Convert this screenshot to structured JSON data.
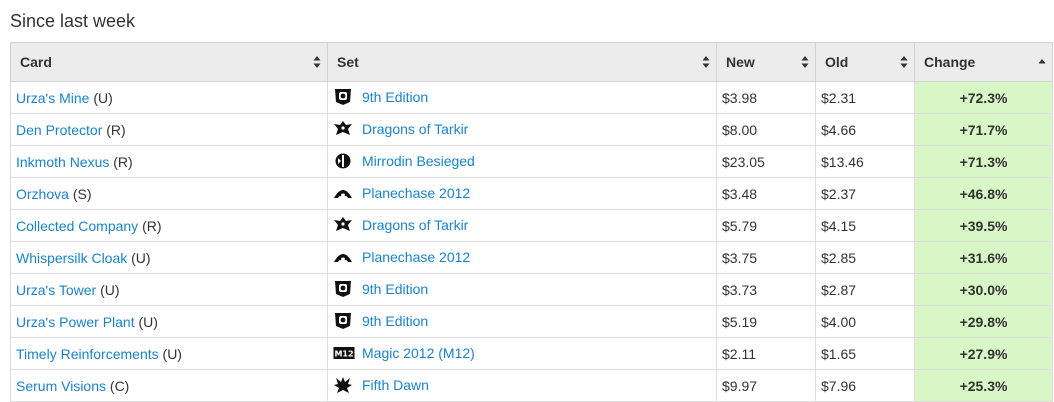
{
  "heading": "Since last week",
  "columns": [
    {
      "label": "Card",
      "sort": "both"
    },
    {
      "label": "Set",
      "sort": "both"
    },
    {
      "label": "New",
      "sort": "both"
    },
    {
      "label": "Old",
      "sort": "both"
    },
    {
      "label": "Change",
      "sort": "up"
    }
  ],
  "rows": [
    {
      "card": "Urza's Mine",
      "rarity": "(U)",
      "set": "9th Edition",
      "set_icon": "9th-edition-icon",
      "new": "$3.98",
      "old": "$2.31",
      "change": "+72.3%"
    },
    {
      "card": "Den Protector",
      "rarity": "(R)",
      "set": "Dragons of Tarkir",
      "set_icon": "dragons-of-tarkir-icon",
      "new": "$8.00",
      "old": "$4.66",
      "change": "+71.7%"
    },
    {
      "card": "Inkmoth Nexus",
      "rarity": "(R)",
      "set": "Mirrodin Besieged",
      "set_icon": "mirrodin-besieged-icon",
      "new": "$23.05",
      "old": "$13.46",
      "change": "+71.3%"
    },
    {
      "card": "Orzhova",
      "rarity": "(S)",
      "set": "Planechase 2012",
      "set_icon": "planechase-2012-icon",
      "new": "$3.48",
      "old": "$2.37",
      "change": "+46.8%"
    },
    {
      "card": "Collected Company",
      "rarity": "(R)",
      "set": "Dragons of Tarkir",
      "set_icon": "dragons-of-tarkir-icon",
      "new": "$5.79",
      "old": "$4.15",
      "change": "+39.5%"
    },
    {
      "card": "Whispersilk Cloak",
      "rarity": "(U)",
      "set": "Planechase 2012",
      "set_icon": "planechase-2012-icon",
      "new": "$3.75",
      "old": "$2.85",
      "change": "+31.6%"
    },
    {
      "card": "Urza's Tower",
      "rarity": "(U)",
      "set": "9th Edition",
      "set_icon": "9th-edition-icon",
      "new": "$3.73",
      "old": "$2.87",
      "change": "+30.0%"
    },
    {
      "card": "Urza's Power Plant",
      "rarity": "(U)",
      "set": "9th Edition",
      "set_icon": "9th-edition-icon",
      "new": "$5.19",
      "old": "$4.00",
      "change": "+29.8%"
    },
    {
      "card": "Timely Reinforcements",
      "rarity": "(U)",
      "set": "Magic 2012 (M12)",
      "set_icon": "magic-2012-icon",
      "new": "$2.11",
      "old": "$1.65",
      "change": "+27.9%"
    },
    {
      "card": "Serum Visions",
      "rarity": "(C)",
      "set": "Fifth Dawn",
      "set_icon": "fifth-dawn-icon",
      "new": "$9.97",
      "old": "$7.96",
      "change": "+25.3%"
    }
  ],
  "colors": {
    "link": "#1a83c9",
    "change_bg": "#d9f7c6",
    "header_bg": "#ececec"
  }
}
